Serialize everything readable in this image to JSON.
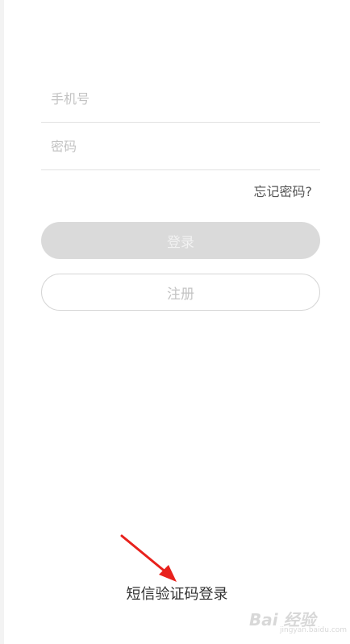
{
  "form": {
    "phone_placeholder": "手机号",
    "password_placeholder": "密码",
    "forgot_password": "忘记密码?",
    "login_label": "登录",
    "register_label": "注册"
  },
  "footer": {
    "sms_login": "短信验证码登录"
  },
  "watermark": {
    "brand": "Bai  经验",
    "url": "jingyan.baidu.com"
  },
  "colors": {
    "login_disabled_bg": "#dadada",
    "annotation_arrow": "#e8211c",
    "divider": "#e2e2e2"
  }
}
